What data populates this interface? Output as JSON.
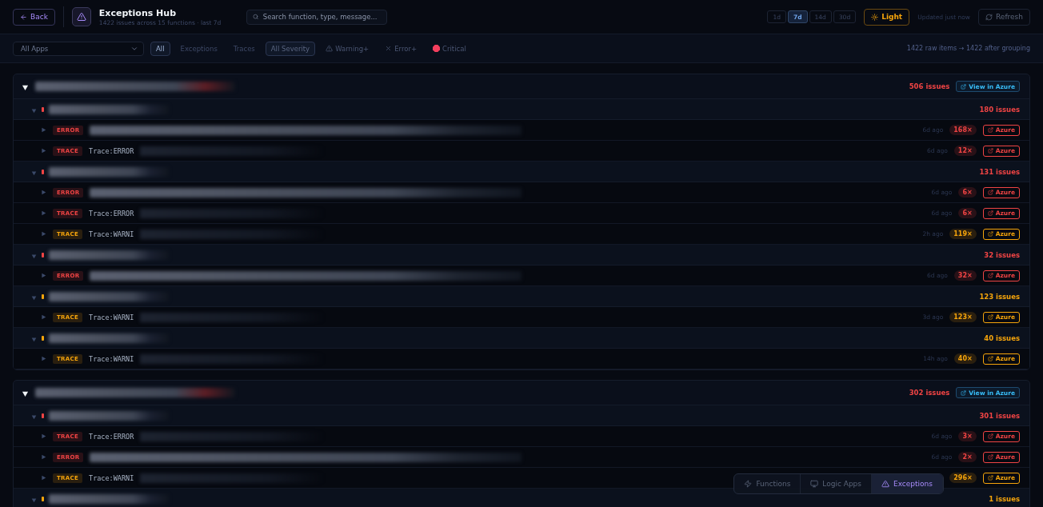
{
  "header": {
    "back": "Back",
    "title": "Exceptions Hub",
    "subtitle": "1422 issues across 15 functions · last 7d",
    "search": {
      "placeholder": "Search function, type, message..."
    },
    "ranges": [
      {
        "label": "1d",
        "selected": false
      },
      {
        "label": "7d",
        "selected": true
      },
      {
        "label": "14d",
        "selected": false
      },
      {
        "label": "30d",
        "selected": false
      }
    ],
    "theme_button": "Light",
    "updated": "Updated just now",
    "refresh": "Refresh"
  },
  "filters": {
    "app_select": "All Apps",
    "types": [
      {
        "label": "All",
        "selected": true
      },
      {
        "label": "Exceptions",
        "selected": false
      },
      {
        "label": "Traces",
        "selected": false
      }
    ],
    "severities": [
      {
        "label": "All Severity",
        "kind": "all",
        "selected": true
      },
      {
        "label": "Warning+",
        "kind": "warning",
        "selected": false
      },
      {
        "label": "Error+",
        "kind": "error",
        "selected": false
      },
      {
        "label": "Critical",
        "kind": "critical",
        "selected": false
      }
    ],
    "summary": "1422 raw items → 1422 after grouping"
  },
  "groups": [
    {
      "expanded": true,
      "color": "#f04444",
      "issues": "506 issues",
      "link": "View in Azure",
      "functions": [
        {
          "expanded": true,
          "color": "#f04444",
          "issues": "180 issues",
          "items": [
            {
              "type": "ERROR",
              "color": "#f04444",
              "age": "6d ago",
              "count": "168×",
              "link": "Azure"
            },
            {
              "type": "TRACE",
              "color": "#f04444",
              "message": "Trace:ERROR",
              "age": "6d ago",
              "count": "12×",
              "link": "Azure"
            }
          ]
        },
        {
          "expanded": true,
          "color": "#f04444",
          "issues": "131 issues",
          "items": [
            {
              "type": "ERROR",
              "color": "#f04444",
              "age": "6d ago",
              "count": "6×",
              "link": "Azure"
            },
            {
              "type": "TRACE",
              "color": "#f04444",
              "message": "Trace:ERROR",
              "age": "6d ago",
              "count": "6×",
              "link": "Azure"
            },
            {
              "type": "TRACE",
              "color": "#f5a40b",
              "message": "Trace:WARNI",
              "age": "2h ago",
              "count": "119×",
              "link": "Azure"
            }
          ]
        },
        {
          "expanded": true,
          "color": "#f04444",
          "issues": "32 issues",
          "items": [
            {
              "type": "ERROR",
              "color": "#f04444",
              "age": "6d ago",
              "count": "32×",
              "link": "Azure"
            }
          ]
        },
        {
          "expanded": true,
          "color": "#f5a40b",
          "issues": "123 issues",
          "items": [
            {
              "type": "TRACE",
              "color": "#f5a40b",
              "message": "Trace:WARNI",
              "age": "3d ago",
              "count": "123×",
              "link": "Azure"
            }
          ]
        },
        {
          "expanded": true,
          "color": "#f5a40b",
          "issues": "40 issues",
          "items": [
            {
              "type": "TRACE",
              "color": "#f5a40b",
              "message": "Trace:WARNI",
              "age": "14h ago",
              "count": "40×",
              "link": "Azure"
            }
          ]
        }
      ]
    },
    {
      "expanded": true,
      "color": "#f04444",
      "issues": "302 issues",
      "link": "View in Azure",
      "functions": [
        {
          "expanded": true,
          "color": "#f04444",
          "issues": "301 issues",
          "items": [
            {
              "type": "TRACE",
              "color": "#f04444",
              "message": "Trace:ERROR",
              "age": "6d ago",
              "count": "3×",
              "link": "Azure"
            },
            {
              "type": "ERROR",
              "color": "#f04444",
              "age": "6d ago",
              "count": "2×",
              "link": "Azure"
            },
            {
              "type": "TRACE",
              "color": "#f5a40b",
              "message": "Trace:WARNI",
              "count": "296×",
              "link": "Azure"
            }
          ]
        },
        {
          "expanded": true,
          "color": "#f5a40b",
          "issues": "1 issues"
        }
      ]
    }
  ],
  "nav": [
    {
      "label": "Functions",
      "kind": "functions",
      "selected": false
    },
    {
      "label": "Logic Apps",
      "kind": "logic",
      "selected": false
    },
    {
      "label": "Exceptions",
      "kind": "exceptions",
      "selected": true
    }
  ]
}
